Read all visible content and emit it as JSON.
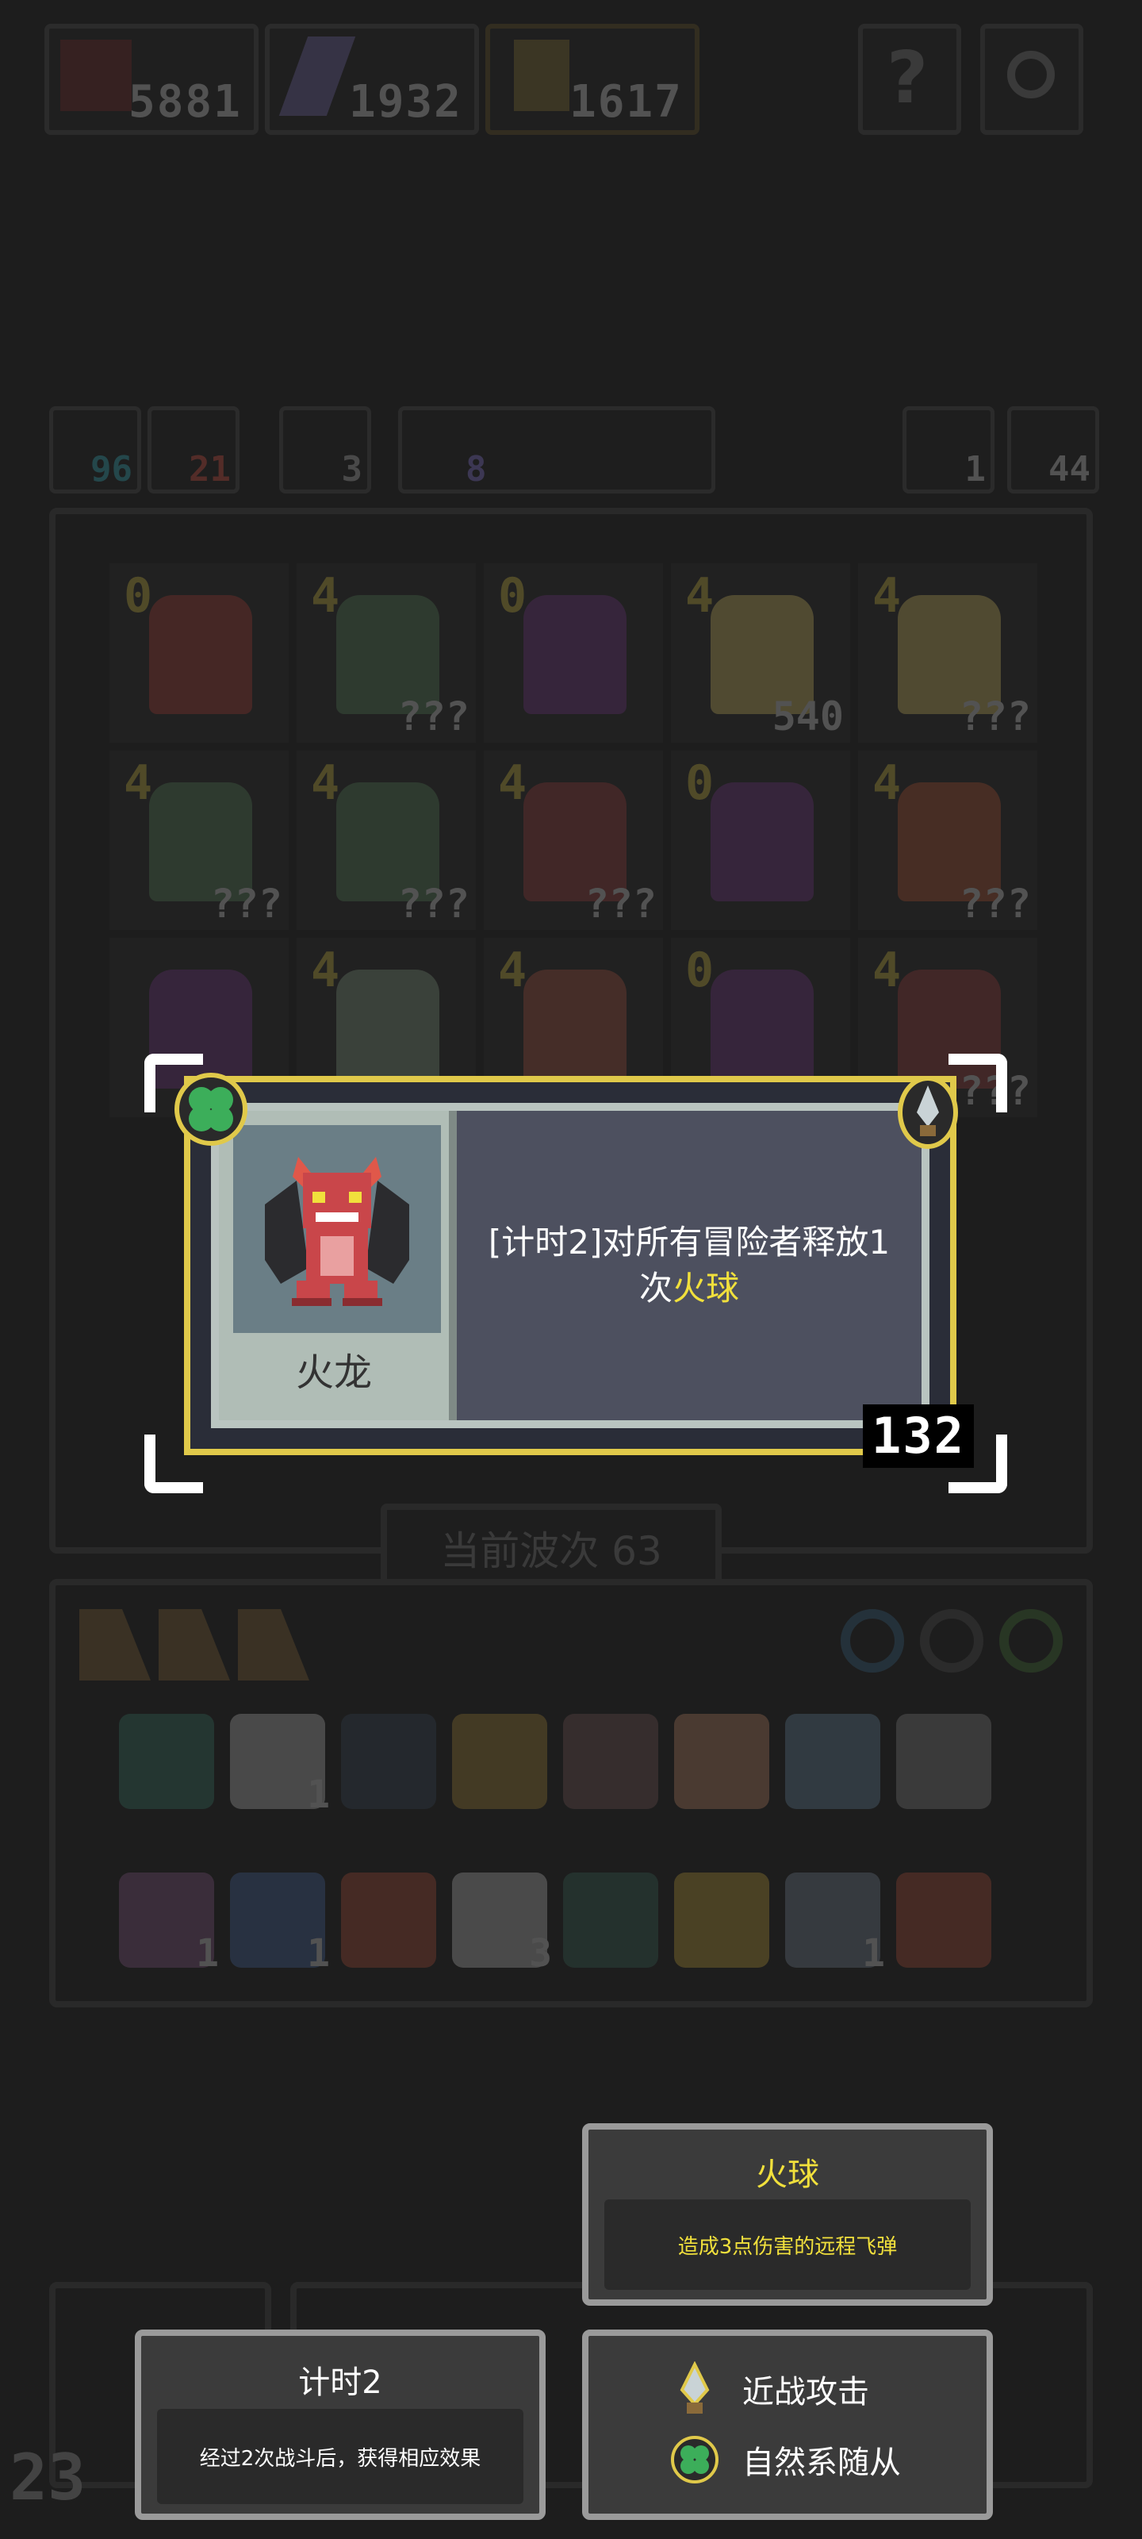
{
  "resources": {
    "r1": {
      "icon": "demon-head-icon",
      "value": "5881"
    },
    "r2": {
      "icon": "lightning-icon",
      "value": "1932"
    },
    "r3": {
      "icon": "hammer-icon",
      "value": "1617"
    }
  },
  "top_buttons": {
    "help_icon": "question-icon",
    "settings_icon": "gear-icon"
  },
  "stats": {
    "s1": {
      "value": "96",
      "color": "#3cb6c7"
    },
    "s2": {
      "value": "21",
      "color": "#e0584a"
    },
    "s3": {
      "value": "3",
      "color": "#bfbfbf"
    },
    "s4": {
      "value": "8",
      "color": "#8f7fe0"
    },
    "refresh": {
      "value": "1"
    },
    "key": {
      "value": "44"
    }
  },
  "grid": {
    "rows": [
      [
        {
          "lvl": "0",
          "q": "",
          "color": "#b0463f"
        },
        {
          "lvl": "4",
          "q": "???",
          "color": "#5d8a62"
        },
        {
          "lvl": "0",
          "q": "",
          "color": "#7a3f8c"
        },
        {
          "lvl": "4",
          "q": "540",
          "color": "#d8c06a"
        },
        {
          "lvl": "4",
          "q": "???",
          "color": "#d8c06a"
        }
      ],
      [
        {
          "lvl": "4",
          "q": "???",
          "color": "#5d8a62"
        },
        {
          "lvl": "4",
          "q": "???",
          "color": "#5d8a62"
        },
        {
          "lvl": "4",
          "q": "???",
          "color": "#a04444"
        },
        {
          "lvl": "0",
          "q": "",
          "color": "#7a3f8c"
        },
        {
          "lvl": "4",
          "q": "???",
          "color": "#b85c3c"
        }
      ],
      [
        {
          "lvl": "",
          "q": "",
          "color": "#7a3f8c"
        },
        {
          "lvl": "4",
          "q": "",
          "color": "#8aa08a"
        },
        {
          "lvl": "4",
          "q": "",
          "color": "#b0594a"
        },
        {
          "lvl": "0",
          "q": "",
          "color": "#7a3f8c"
        },
        {
          "lvl": "4",
          "q": "???",
          "color": "#a04444"
        }
      ]
    ]
  },
  "wave": {
    "label": "当前波次 63"
  },
  "inventory": {
    "orbs": [
      "orb-blue-icon",
      "orb-dark-icon",
      "orb-green-icon"
    ],
    "row1": [
      {
        "icon": "potion-icon",
        "n": ""
      },
      {
        "icon": "bone-icon",
        "n": "1"
      },
      {
        "icon": "shield-icon",
        "n": ""
      },
      {
        "icon": "trophy-icon",
        "n": ""
      },
      {
        "icon": "flask-icon",
        "n": ""
      },
      {
        "icon": "pig-icon",
        "n": ""
      },
      {
        "icon": "feather-icon",
        "n": ""
      },
      {
        "icon": "mirror-icon",
        "n": ""
      }
    ],
    "row2": [
      {
        "icon": "scroll-icon",
        "n": "1"
      },
      {
        "icon": "hourglass-icon",
        "n": "1"
      },
      {
        "icon": "fire-book-icon",
        "n": ""
      },
      {
        "icon": "wings-icon",
        "n": "3"
      },
      {
        "icon": "bell-icon",
        "n": ""
      },
      {
        "icon": "wand-icon",
        "n": ""
      },
      {
        "icon": "anchor-icon",
        "n": "1"
      },
      {
        "icon": "fire-tome-icon",
        "n": ""
      }
    ]
  },
  "card": {
    "name": "火龙",
    "desc_prefix": "[计时2]对所有冒险者释放1次",
    "desc_highlight": "火球",
    "badge": "132",
    "type_icon": "clover-icon",
    "attack_icon": "dagger-icon"
  },
  "tip_fireball": {
    "title": "火球",
    "body": "造成3点伤害的远程飞弹",
    "color": "#f1e03c"
  },
  "tip_timer": {
    "title": "计时2",
    "body": "经过2次战斗后，获得相应效果"
  },
  "tip_tags": {
    "melee": "近战攻击",
    "nature": "自然系随从"
  },
  "bottom_counter": "23"
}
